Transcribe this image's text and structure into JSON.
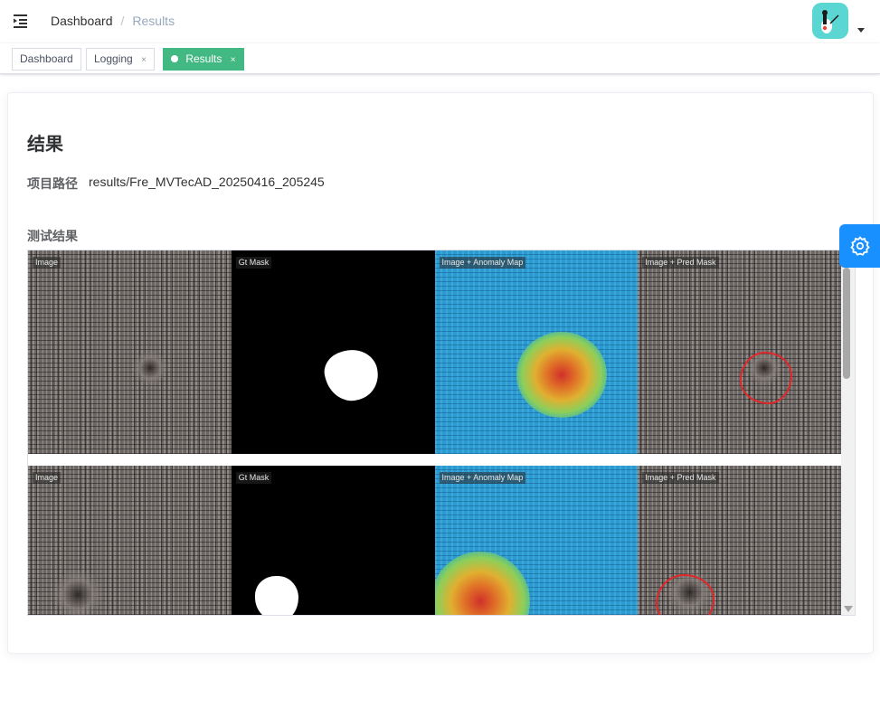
{
  "navbar": {
    "breadcrumb": [
      "Dashboard",
      "Results"
    ],
    "separator": "/"
  },
  "tags": [
    {
      "label": "Dashboard",
      "closable": false,
      "active": false
    },
    {
      "label": "Logging",
      "closable": true,
      "active": false
    },
    {
      "label": "Results",
      "closable": true,
      "active": true
    }
  ],
  "tag_close_glyph": "×",
  "accent_color": "#42b983",
  "settings_color": "#1890ff",
  "page": {
    "title": "结果",
    "path_label": "项目路径",
    "path_value": "results/Fre_MVTecAD_20250416_205245",
    "section_label": "测试结果"
  },
  "result_panels": {
    "image": "Image",
    "gt_mask": "Gt Mask",
    "anomaly_map": "Image + Anomaly Map",
    "pred_mask": "Image + Pred Mask"
  },
  "icons": [
    "hamburger-icon",
    "avatar-icon",
    "caret-down-icon",
    "gear-icon",
    "scroll-down-arrow-icon"
  ]
}
